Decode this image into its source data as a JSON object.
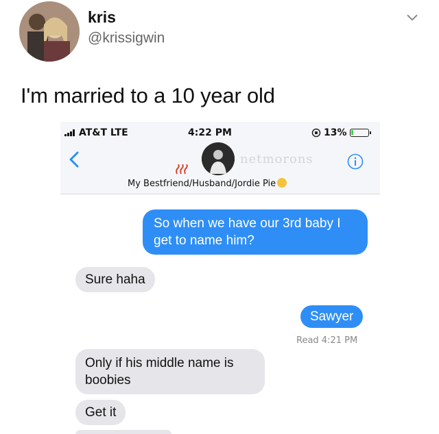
{
  "user": {
    "display_name": "kris",
    "handle": "@krissigwin"
  },
  "tweet": {
    "text": "I'm married to a 10 year old"
  },
  "icons": {
    "menu": "chevron-down-icon",
    "back": "chevron-left-icon",
    "info": "info-icon"
  },
  "phone": {
    "status": {
      "carrier": "AT&T  LTE",
      "time": "4:22 PM",
      "battery": "13%",
      "battery_level": 0.13
    },
    "watermark": "netmorons",
    "contact_name": "My Bestfriend/Husband/Jordie Pie",
    "messages": [
      {
        "side": "sent",
        "text": "So when we have our 3rd baby I get to name him?"
      },
      {
        "side": "received",
        "text": "Sure haha"
      },
      {
        "side": "sent",
        "text": "Sawyer"
      },
      {
        "side": "received",
        "text": "Only if his middle name is boobies"
      },
      {
        "side": "received",
        "text": "Get it"
      }
    ],
    "read_receipt": "Read 4:21 PM"
  },
  "colors": {
    "sent_bubble": "#2e8ef6",
    "received_bubble": "#e5e5ea",
    "handle_text": "#666666"
  }
}
